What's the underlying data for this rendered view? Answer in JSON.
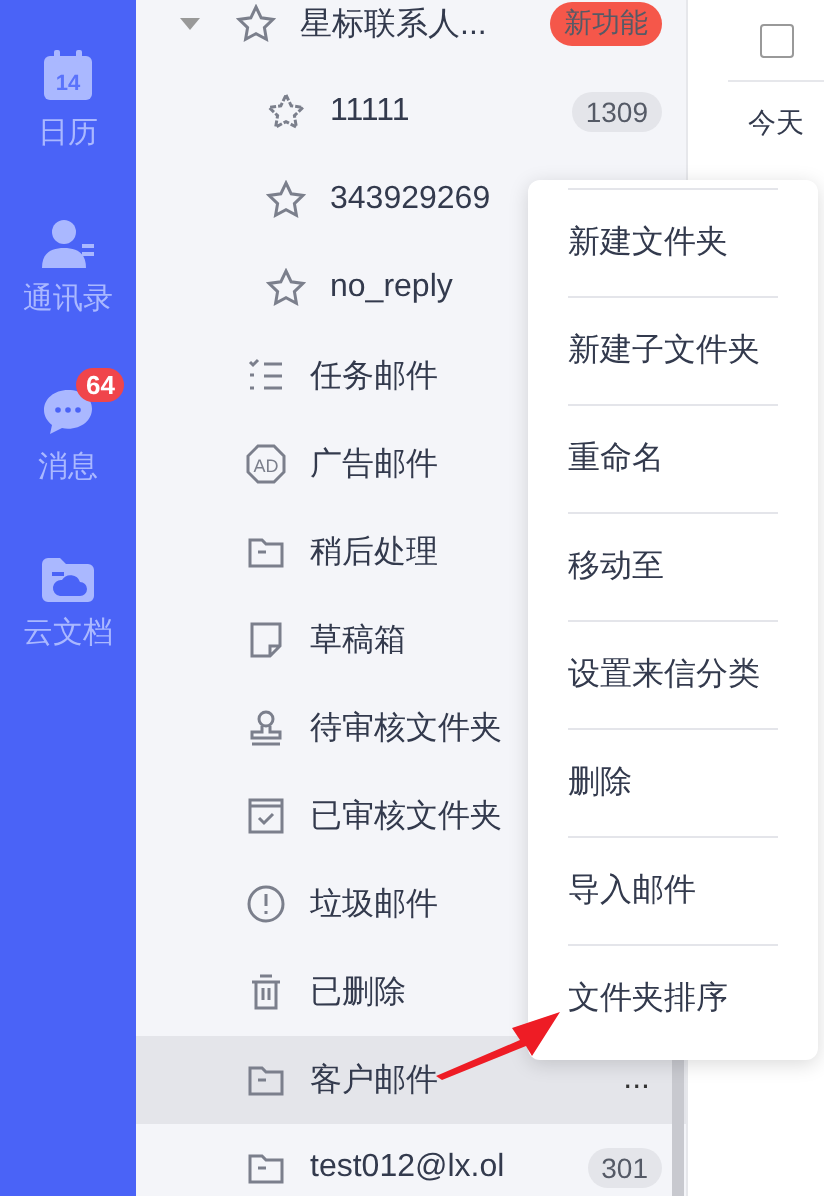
{
  "nav_rail": {
    "items": [
      {
        "label": "日历",
        "icon_text": "14"
      },
      {
        "label": "通讯录"
      },
      {
        "label": "消息",
        "badge": "64"
      },
      {
        "label": "云文档"
      }
    ]
  },
  "folders": [
    {
      "label": "星标联系人...",
      "expanded": true,
      "selected": false,
      "badge": {
        "text": "新功能",
        "color": "#f5574a"
      },
      "children": [
        {
          "label": "11111",
          "selected": false,
          "badge": {
            "text": "1309",
            "color": "#e4e5ea"
          }
        },
        {
          "label": "343929269",
          "selected": false
        },
        {
          "label": "no_reply",
          "selected": false
        }
      ]
    },
    {
      "label": "任务邮件",
      "selected": false
    },
    {
      "label": "广告邮件",
      "selected": false,
      "icon_text": "AD"
    },
    {
      "label": "稍后处理",
      "selected": false
    },
    {
      "label": "草稿箱",
      "selected": false
    },
    {
      "label": "待审核文件夹",
      "selected": false
    },
    {
      "label": "已审核文件夹",
      "selected": false
    },
    {
      "label": "垃圾邮件",
      "selected": false
    },
    {
      "label": "已删除",
      "selected": false
    },
    {
      "label": "客户邮件",
      "selected": true,
      "more": "..."
    },
    {
      "label": "test012@lx.ol",
      "selected": false,
      "badge": {
        "text": "301",
        "color": "#e4e5ea"
      }
    }
  ],
  "mail_pane": {
    "select_all": {
      "checked": false
    },
    "date_group": "今天"
  },
  "context_menu": {
    "items": [
      "新建文件夹",
      "新建子文件夹",
      "重命名",
      "移动至",
      "设置来信分类",
      "删除",
      "导入邮件",
      "文件夹排序"
    ]
  }
}
